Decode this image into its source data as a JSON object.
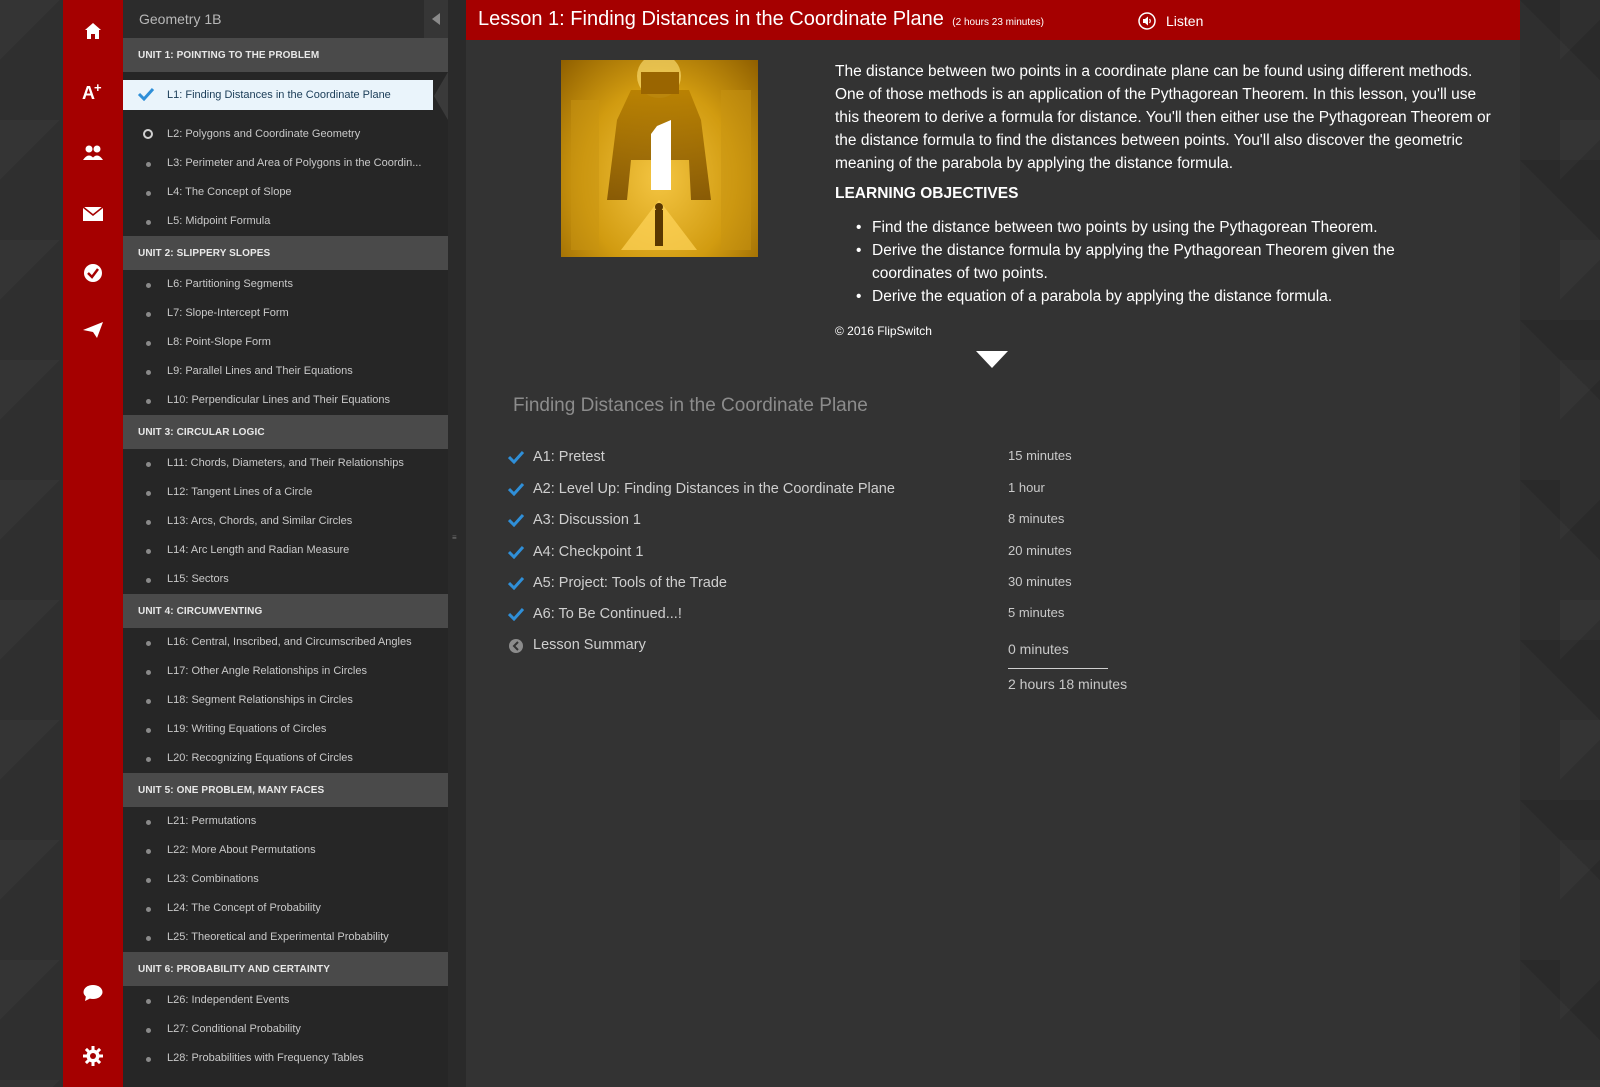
{
  "rail": {
    "items": [
      {
        "icon": "home-icon"
      },
      {
        "icon": "grades-icon"
      },
      {
        "icon": "people-icon"
      },
      {
        "icon": "mail-icon"
      },
      {
        "icon": "checkmark-icon"
      },
      {
        "icon": "send-icon"
      },
      {
        "icon": "chat-icon"
      },
      {
        "icon": "gear-icon"
      }
    ]
  },
  "sidebar": {
    "course_title": "Geometry 1B",
    "units": [
      {
        "label": "UNIT 1: POINTING TO THE PROBLEM",
        "lessons": [
          {
            "label": "L1: Finding Distances in the Coordinate Plane"
          },
          {
            "label": "L2: Polygons and Coordinate Geometry"
          },
          {
            "label": "L3: Perimeter and Area of Polygons in the Coordin..."
          },
          {
            "label": "L4: The Concept of Slope"
          },
          {
            "label": "L5: Midpoint Formula"
          }
        ]
      },
      {
        "label": "UNIT 2: SLIPPERY SLOPES",
        "lessons": [
          {
            "label": "L6: Partitioning Segments"
          },
          {
            "label": "L7: Slope-Intercept Form"
          },
          {
            "label": "L8: Point-Slope Form"
          },
          {
            "label": "L9: Parallel Lines and Their Equations"
          },
          {
            "label": "L10: Perpendicular Lines and Their Equations"
          }
        ]
      },
      {
        "label": "UNIT 3: CIRCULAR LOGIC",
        "lessons": [
          {
            "label": "L11: Chords, Diameters, and Their Relationships"
          },
          {
            "label": "L12: Tangent Lines of a Circle"
          },
          {
            "label": "L13: Arcs, Chords, and Similar Circles"
          },
          {
            "label": "L14: Arc Length and Radian Measure"
          },
          {
            "label": "L15: Sectors"
          }
        ]
      },
      {
        "label": "UNIT 4: CIRCUMVENTING",
        "lessons": [
          {
            "label": "L16: Central, Inscribed, and Circumscribed Angles"
          },
          {
            "label": "L17: Other Angle Relationships in Circles"
          },
          {
            "label": "L18: Segment Relationships in Circles"
          },
          {
            "label": "L19: Writing Equations of Circles"
          },
          {
            "label": "L20: Recognizing Equations of Circles"
          }
        ]
      },
      {
        "label": "UNIT 5: ONE PROBLEM, MANY FACES",
        "lessons": [
          {
            "label": "L21: Permutations"
          },
          {
            "label": "L22: More About Permutations"
          },
          {
            "label": "L23: Combinations"
          },
          {
            "label": "L24: The Concept of Probability"
          },
          {
            "label": "L25: Theoretical and Experimental Probability"
          }
        ]
      },
      {
        "label": "UNIT 6: PROBABILITY AND CERTAINTY",
        "lessons": [
          {
            "label": "L26: Independent Events"
          },
          {
            "label": "L27: Conditional Probability"
          },
          {
            "label": "L28: Probabilities with Frequency Tables"
          }
        ]
      }
    ]
  },
  "main": {
    "title": "Lesson 1: Finding Distances in the Coordinate Plane",
    "duration": "(2 hours 23 minutes)",
    "listen_label": "Listen",
    "hero_numeral": "1",
    "description": "The distance between two points in a coordinate plane can be found using different methods. One of those methods is an application of the Pythagorean Theorem. In this lesson, you'll use this theorem to derive a formula for distance. You'll then either use the Pythagorean Theorem or the distance formula to find the distances between points. You'll also discover the geometric meaning of the parabola by applying the distance formula.",
    "objectives_heading": "LEARNING OBJECTIVES",
    "objectives": [
      "Find the distance between two points by using the Pythagorean Theorem.",
      "Derive the distance formula by applying the Pythagorean Theorem given the coordinates of two points.",
      "Derive the equation of a parabola by applying the distance formula."
    ],
    "copyright": "© 2016 FlipSwitch",
    "section_title": "Finding Distances in the Coordinate Plane",
    "activities": [
      {
        "name": "A1: Pretest",
        "time": "15 minutes",
        "status": "complete"
      },
      {
        "name": "A2: Level Up: Finding Distances in the Coordinate Plane",
        "time": "1 hour",
        "status": "complete"
      },
      {
        "name": "A3: Discussion 1",
        "time": "8 minutes",
        "status": "complete"
      },
      {
        "name": "A4: Checkpoint 1",
        "time": "20 minutes",
        "status": "complete"
      },
      {
        "name": "A5: Project: Tools of the Trade",
        "time": "30 minutes",
        "status": "complete"
      },
      {
        "name": "A6: To Be Continued...!",
        "time": "5 minutes",
        "status": "complete"
      },
      {
        "name": "Lesson Summary",
        "time": "0 minutes",
        "status": "summary"
      }
    ],
    "total_time": "2 hours 18 minutes"
  },
  "colors": {
    "brand_red": "#a50000",
    "check_blue": "#2f8fd8",
    "active_lesson_bg": "#eaf4fb"
  }
}
